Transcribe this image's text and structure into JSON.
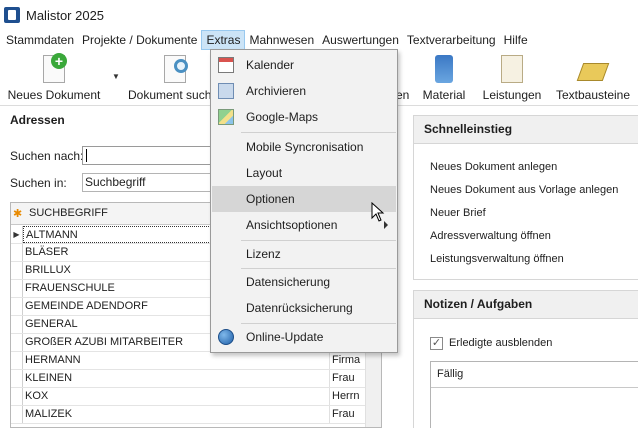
{
  "window": {
    "title": "Malistor 2025"
  },
  "menubar": {
    "items": [
      "Stammdaten",
      "Projekte / Dokumente",
      "Extras",
      "Mahnwesen",
      "Auswertungen",
      "Textverarbeitung",
      "Hilfe"
    ],
    "active": "Extras"
  },
  "ribbon": {
    "new_document": "Neues Dokument",
    "document_search": "Dokument such",
    "partial_hidden": "en",
    "material": "Material",
    "leistungen": "Leistungen",
    "textbausteine": "Textbausteine"
  },
  "adressen": {
    "title": "Adressen",
    "search_label": "Suchen nach:",
    "search_value": "",
    "search_in_label": "Suchen in:",
    "search_in_value": "Suchbegriff",
    "column_header": "SUCHBEGRIFF",
    "rows": [
      {
        "name": "ALTMANN",
        "anrede": ""
      },
      {
        "name": "BLÄSER",
        "anrede": ""
      },
      {
        "name": "BRILLUX",
        "anrede": ""
      },
      {
        "name": "FRAUENSCHULE",
        "anrede": ""
      },
      {
        "name": "GEMEINDE ADENDORF",
        "anrede": ""
      },
      {
        "name": "GENERAL",
        "anrede": ""
      },
      {
        "name": "GROßER AZUBI MITARBEITER",
        "anrede": ""
      },
      {
        "name": "HERMANN",
        "anrede": "Firma"
      },
      {
        "name": "KLEINEN",
        "anrede": "Frau"
      },
      {
        "name": "KOX",
        "anrede": "Herrn"
      },
      {
        "name": "MALIZEK",
        "anrede": "Frau"
      }
    ]
  },
  "schnelleinstieg": {
    "title": "Schnelleinstieg",
    "links": [
      "Neues Dokument anlegen",
      "Neues Dokument aus Vorlage anlegen",
      "Neuer Brief",
      "Adressverwaltung öffnen",
      "Leistungsverwaltung öffnen"
    ]
  },
  "notizen": {
    "title": "Notizen / Aufgaben",
    "checkbox_label": "Erledigte ausblenden",
    "checked": true,
    "column_header": "Fällig"
  },
  "extras_menu": {
    "kalender": "Kalender",
    "archivieren": "Archivieren",
    "google_maps": "Google-Maps",
    "mobile_sync": "Mobile Syncronisation",
    "layout": "Layout",
    "optionen": "Optionen",
    "ansichtsoptionen": "Ansichtsoptionen",
    "lizenz": "Lizenz",
    "datensicherung": "Datensicherung",
    "datenruecksicherung": "Datenrücksicherung",
    "online_update": "Online-Update",
    "hovered": "Optionen"
  }
}
